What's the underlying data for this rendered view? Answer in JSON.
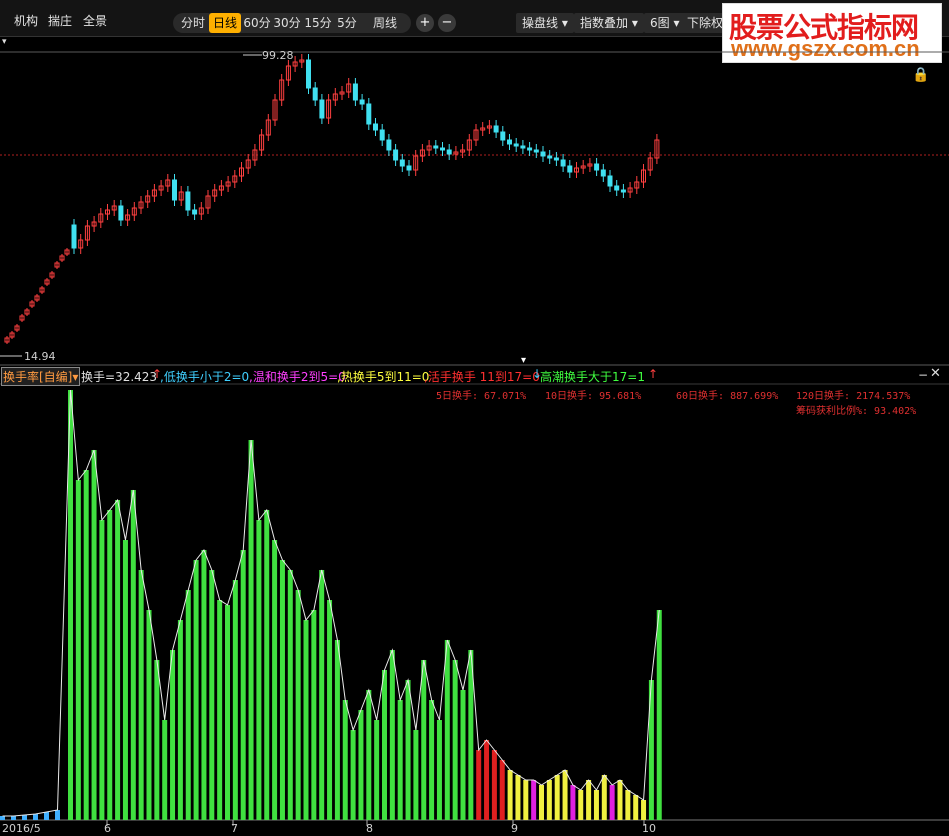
{
  "toolbar": {
    "menu_left": [
      "机构",
      "揣庄",
      "全景"
    ],
    "periods": [
      "分时",
      "日线",
      "60分",
      "30分",
      "15分",
      "5分",
      "周线"
    ],
    "active_period": "日线",
    "zoom_in": "+",
    "zoom_out": "−",
    "dropdowns": [
      "操盘线",
      "指数叠加",
      "6图",
      "下除权"
    ]
  },
  "watermark": {
    "line1": "股票公式指标网",
    "line2": "www.gszx.com.cn"
  },
  "price_chart": {
    "high_label": "99.28",
    "low_label": "14.94",
    "high": 99.28,
    "low": 14.94,
    "colors": {
      "up": "#ff4040",
      "down": "#40e0f0",
      "ref_line": "#b02020"
    }
  },
  "indicator": {
    "name": "换手率[自编]",
    "value_text": "换手=32.423",
    "legend": [
      {
        "text": ",低换手小于2=0",
        "color": "#40d0ff"
      },
      {
        "text": ",温和换手2到5=0",
        "color": "#ff40ff"
      },
      {
        "text": ",热换手5到11=0",
        "color": "#ffff40"
      },
      {
        "text": ",活手换手 11到17=0",
        "color": "#ff3030"
      },
      {
        "text": " 高潮换手大于17=1",
        "color": "#40ff40"
      }
    ],
    "stats_row1": [
      "5日换手: 67.071%",
      "10日换手: 95.681%",
      "60日换手: 887.699%",
      "120日换手: 2174.537%"
    ],
    "stats_row2": "筹码获利比例%: 93.402%",
    "colors": {
      "heat": "#40e040",
      "active": "#e02020",
      "hot": "#f0f040",
      "mild": "#e020e0",
      "low": "#40b0ff"
    }
  },
  "x_axis": {
    "labels": [
      "2016/5",
      "6",
      "7",
      "8",
      "9",
      "10"
    ]
  }
}
